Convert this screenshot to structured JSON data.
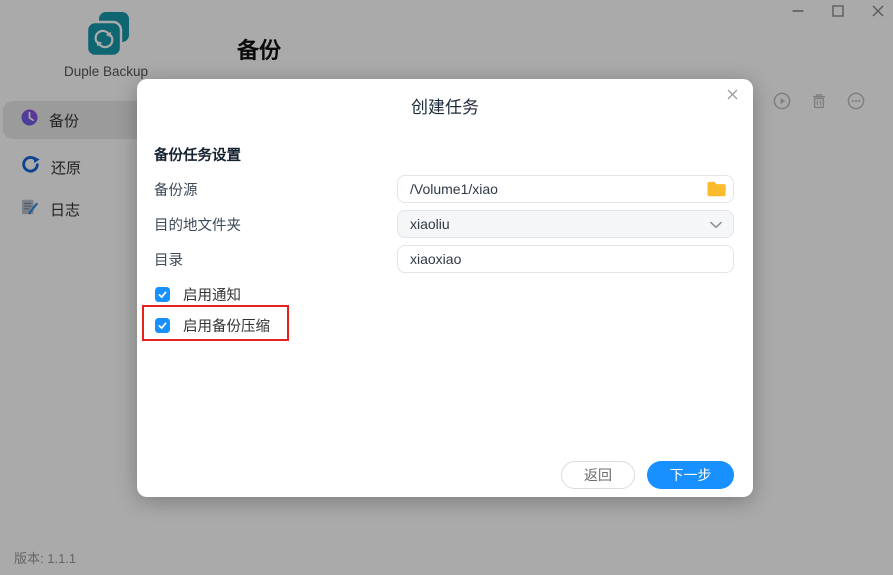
{
  "app": {
    "logo_text": "Duple Backup",
    "page_title": "备份",
    "version_label": "版本: 1.1.1",
    "window_icons": [
      "minimize-icon",
      "maximize-icon",
      "close-icon"
    ]
  },
  "sidebar": {
    "items": [
      {
        "label": "备份",
        "icon": "clock-icon",
        "active": true
      },
      {
        "label": "还原",
        "icon": "restore-arrow-icon",
        "active": false
      },
      {
        "label": "日志",
        "icon": "log-document-icon",
        "active": false
      }
    ]
  },
  "toolbar": {
    "icons": [
      "play-circle-icon",
      "trash-icon",
      "more-circle-icon"
    ]
  },
  "modal": {
    "title": "创建任务",
    "close_glyph": "✕",
    "section_heading": "备份任务设置",
    "fields": [
      {
        "label": "备份源",
        "value": "/Volume1/xiao",
        "type": "input-with-folder-button"
      },
      {
        "label": "目的地文件夹",
        "value": "xiaoliu",
        "type": "select"
      },
      {
        "label": "目录",
        "value": "xiaoxiao",
        "type": "input"
      }
    ],
    "checkboxes": [
      {
        "label": "启用通知",
        "checked": true,
        "highlighted": false
      },
      {
        "label": "启用备份压缩",
        "checked": true,
        "highlighted": true
      }
    ],
    "buttons": {
      "back": "返回",
      "next": "下一步"
    }
  },
  "colors": {
    "primary_blue": "#1890ff",
    "checkbox_blue": "#1890ff",
    "annotation_red": "#e5231b",
    "folder_amber": "#fbbb2c",
    "logo_teal": "#1798ab",
    "clock_purple_gradient": [
      "#5b67e8",
      "#9c4de4"
    ],
    "restore_blue": "#1565d8",
    "active_item_bg": "#e9e9e9",
    "overlay": "rgba(0,0,0,0.335)"
  }
}
